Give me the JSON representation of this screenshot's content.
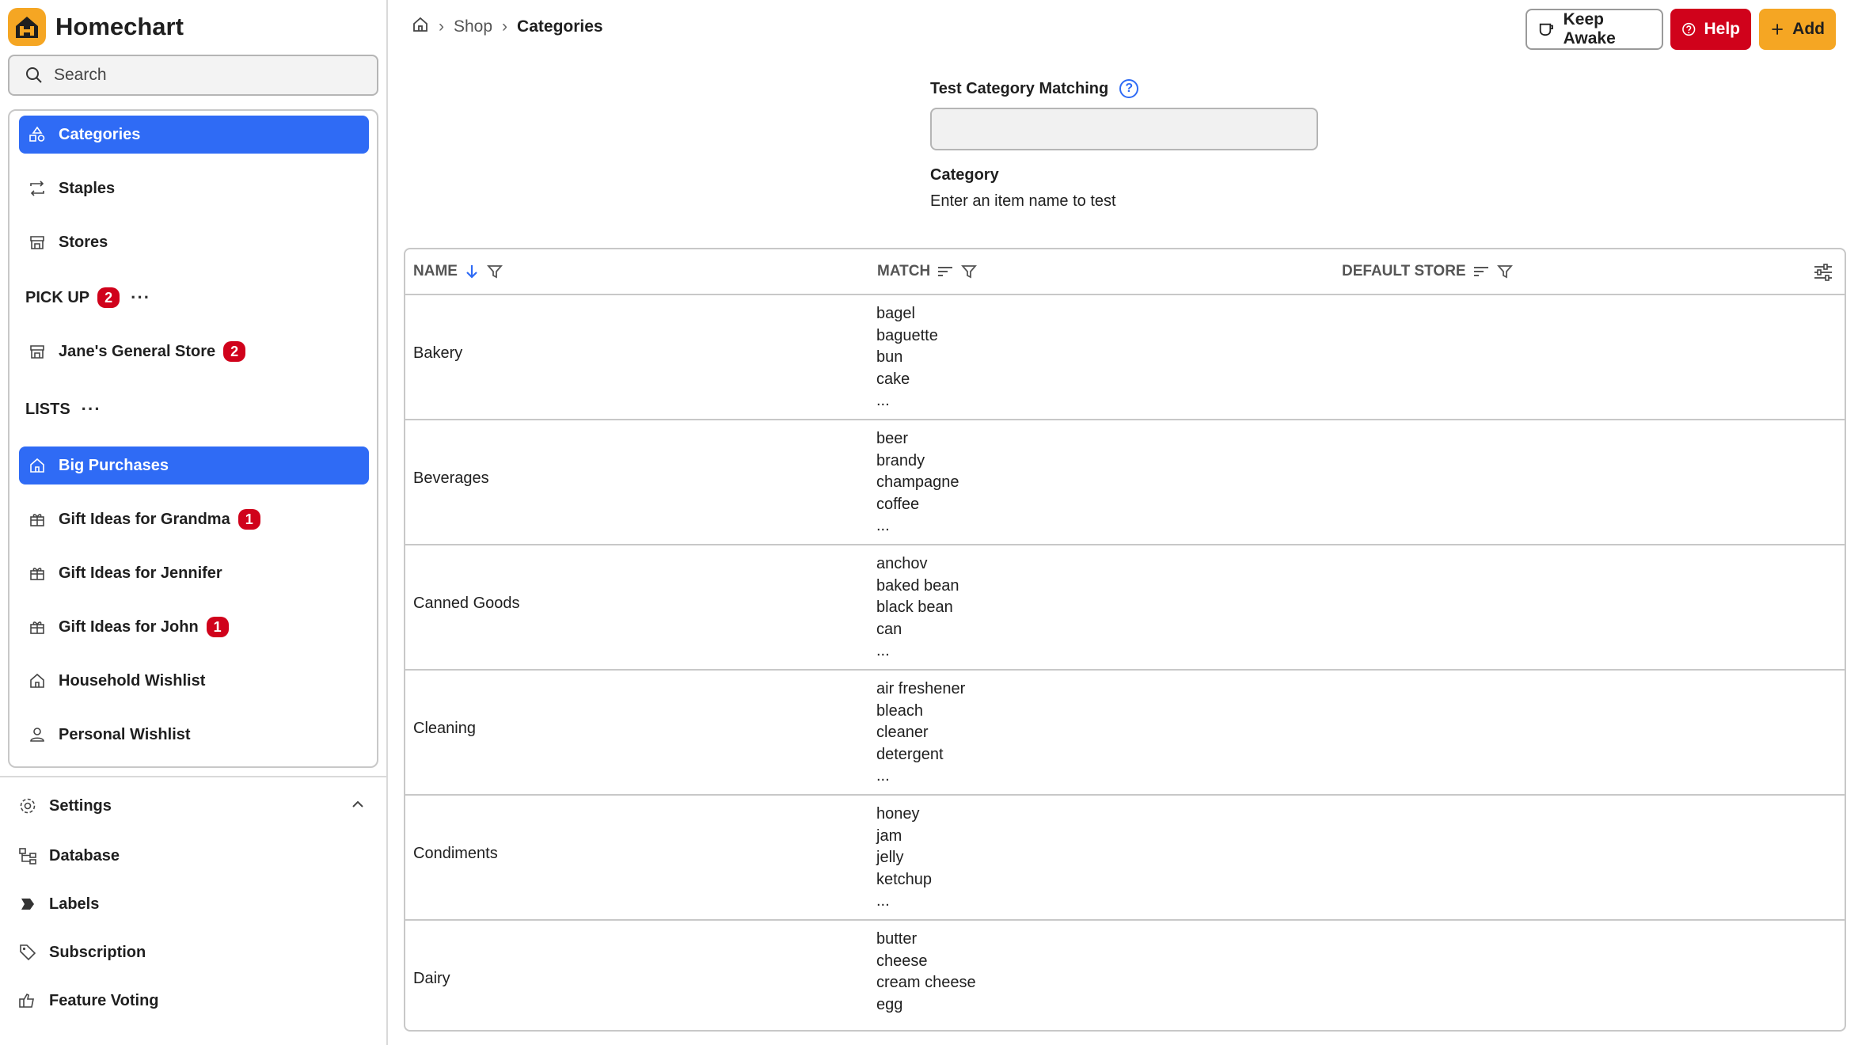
{
  "app": {
    "name": "Homechart"
  },
  "search": {
    "placeholder": "Search"
  },
  "nav": {
    "categories": "Categories",
    "staples": "Staples",
    "stores": "Stores",
    "pickup": {
      "label": "PICK UP",
      "count": "2"
    },
    "store_item": {
      "label": "Jane's General Store",
      "count": "2"
    },
    "lists": "LISTS",
    "big_purchases": "Big Purchases",
    "gift_grandma": {
      "label": "Gift Ideas for Grandma",
      "count": "1"
    },
    "gift_jennifer": "Gift Ideas for Jennifer",
    "gift_john": {
      "label": "Gift Ideas for John",
      "count": "1"
    },
    "household_wishlist": "Household Wishlist",
    "personal_wishlist": "Personal Wishlist",
    "more": "···"
  },
  "bottom_nav": {
    "settings": "Settings",
    "database": "Database",
    "labels": "Labels",
    "subscription": "Subscription",
    "feature_voting": "Feature Voting"
  },
  "breadcrumb": {
    "shop": "Shop",
    "current": "Categories"
  },
  "buttons": {
    "keep_awake": "Keep Awake",
    "help": "Help",
    "add": "Add"
  },
  "test": {
    "label": "Test Category Matching",
    "category_label": "Category",
    "category_value": "Enter an item name to test"
  },
  "table": {
    "columns": {
      "name": "NAME",
      "match": "MATCH",
      "default_store": "DEFAULT STORE"
    },
    "rows": [
      {
        "name": "Bakery",
        "match": [
          "bagel",
          "baguette",
          "bun",
          "cake",
          "..."
        ]
      },
      {
        "name": "Beverages",
        "match": [
          "beer",
          "brandy",
          "champagne",
          "coffee",
          "..."
        ]
      },
      {
        "name": "Canned Goods",
        "match": [
          "anchov",
          "baked bean",
          "black bean",
          "can",
          "..."
        ]
      },
      {
        "name": "Cleaning",
        "match": [
          "air freshener",
          "bleach",
          "cleaner",
          "detergent",
          "..."
        ]
      },
      {
        "name": "Condiments",
        "match": [
          "honey",
          "jam",
          "jelly",
          "ketchup",
          "..."
        ]
      },
      {
        "name": "Dairy",
        "match": [
          "butter",
          "cheese",
          "cream cheese",
          "egg"
        ]
      }
    ]
  },
  "colors": {
    "primary": "#2f6bf5",
    "danger": "#d0021b",
    "accent": "#f5a623"
  }
}
